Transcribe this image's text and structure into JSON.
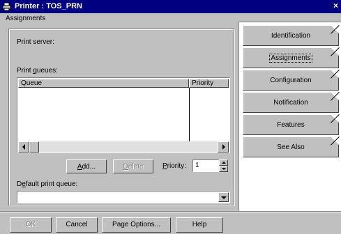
{
  "window": {
    "title": "Printer : TOS_PRN",
    "close_glyph": "×"
  },
  "panel": {
    "heading": "Assignments",
    "print_server_label": "Print server:",
    "print_queues_label_pre": "Print ",
    "print_queues_label_ul": "q",
    "print_queues_label_post": "ueues:",
    "columns": [
      "Queue",
      "Priority"
    ],
    "add_button": {
      "ul": "A",
      "rest": "dd..."
    },
    "delete_button": {
      "ul": "D",
      "rest": "elete"
    },
    "priority_label": {
      "ul": "P",
      "rest": "riority:"
    },
    "priority_value": "1",
    "default_queue_label": {
      "pre": "D",
      "ul": "e",
      "post": "fault print queue:"
    },
    "default_queue_value": ""
  },
  "tabs": [
    "Identification",
    "Assignments",
    "Configuration",
    "Notification",
    "Features",
    "See Also"
  ],
  "active_tab_index": 1,
  "buttons": {
    "ok": "OK",
    "cancel": "Cancel",
    "page_options": "Page Options...",
    "help": "Help"
  }
}
